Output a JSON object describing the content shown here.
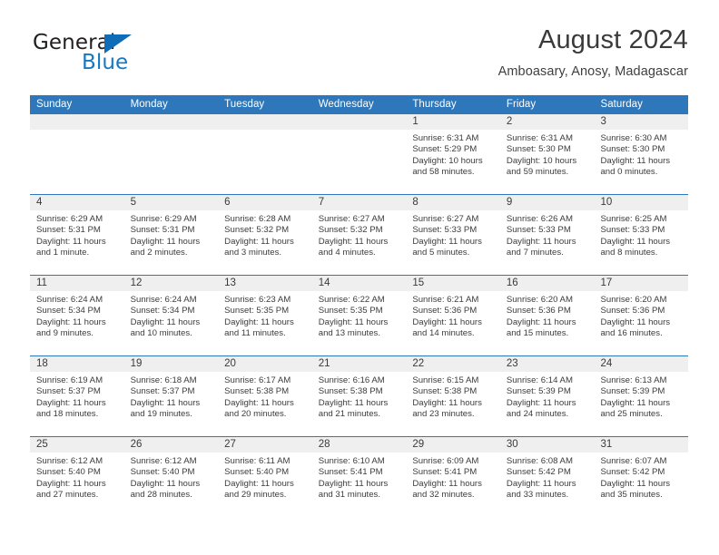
{
  "brand": {
    "name_top": "General",
    "name_bottom": "Blue",
    "triangle_icon": "blue-triangle-icon",
    "color_dark": "#231f20",
    "color_blue": "#1479c4"
  },
  "header": {
    "title": "August 2024",
    "subtitle": "Amboasary, Anosy, Madagascar"
  },
  "theme": {
    "header_blue": "#2e77bb",
    "daynum_band": "#efefef",
    "text": "#3c3c3c"
  },
  "calendar": {
    "weekdays": [
      "Sunday",
      "Monday",
      "Tuesday",
      "Wednesday",
      "Thursday",
      "Friday",
      "Saturday"
    ],
    "weeks": [
      [
        {
          "day": "",
          "empty": true
        },
        {
          "day": "",
          "empty": true
        },
        {
          "day": "",
          "empty": true
        },
        {
          "day": "",
          "empty": true
        },
        {
          "day": "1",
          "sunrise": "Sunrise: 6:31 AM",
          "sunset": "Sunset: 5:29 PM",
          "daylight": "Daylight: 10 hours and 58 minutes."
        },
        {
          "day": "2",
          "sunrise": "Sunrise: 6:31 AM",
          "sunset": "Sunset: 5:30 PM",
          "daylight": "Daylight: 10 hours and 59 minutes."
        },
        {
          "day": "3",
          "sunrise": "Sunrise: 6:30 AM",
          "sunset": "Sunset: 5:30 PM",
          "daylight": "Daylight: 11 hours and 0 minutes."
        }
      ],
      [
        {
          "day": "4",
          "sunrise": "Sunrise: 6:29 AM",
          "sunset": "Sunset: 5:31 PM",
          "daylight": "Daylight: 11 hours and 1 minute."
        },
        {
          "day": "5",
          "sunrise": "Sunrise: 6:29 AM",
          "sunset": "Sunset: 5:31 PM",
          "daylight": "Daylight: 11 hours and 2 minutes."
        },
        {
          "day": "6",
          "sunrise": "Sunrise: 6:28 AM",
          "sunset": "Sunset: 5:32 PM",
          "daylight": "Daylight: 11 hours and 3 minutes."
        },
        {
          "day": "7",
          "sunrise": "Sunrise: 6:27 AM",
          "sunset": "Sunset: 5:32 PM",
          "daylight": "Daylight: 11 hours and 4 minutes."
        },
        {
          "day": "8",
          "sunrise": "Sunrise: 6:27 AM",
          "sunset": "Sunset: 5:33 PM",
          "daylight": "Daylight: 11 hours and 5 minutes."
        },
        {
          "day": "9",
          "sunrise": "Sunrise: 6:26 AM",
          "sunset": "Sunset: 5:33 PM",
          "daylight": "Daylight: 11 hours and 7 minutes."
        },
        {
          "day": "10",
          "sunrise": "Sunrise: 6:25 AM",
          "sunset": "Sunset: 5:33 PM",
          "daylight": "Daylight: 11 hours and 8 minutes."
        }
      ],
      [
        {
          "day": "11",
          "sunrise": "Sunrise: 6:24 AM",
          "sunset": "Sunset: 5:34 PM",
          "daylight": "Daylight: 11 hours and 9 minutes."
        },
        {
          "day": "12",
          "sunrise": "Sunrise: 6:24 AM",
          "sunset": "Sunset: 5:34 PM",
          "daylight": "Daylight: 11 hours and 10 minutes."
        },
        {
          "day": "13",
          "sunrise": "Sunrise: 6:23 AM",
          "sunset": "Sunset: 5:35 PM",
          "daylight": "Daylight: 11 hours and 11 minutes."
        },
        {
          "day": "14",
          "sunrise": "Sunrise: 6:22 AM",
          "sunset": "Sunset: 5:35 PM",
          "daylight": "Daylight: 11 hours and 13 minutes."
        },
        {
          "day": "15",
          "sunrise": "Sunrise: 6:21 AM",
          "sunset": "Sunset: 5:36 PM",
          "daylight": "Daylight: 11 hours and 14 minutes."
        },
        {
          "day": "16",
          "sunrise": "Sunrise: 6:20 AM",
          "sunset": "Sunset: 5:36 PM",
          "daylight": "Daylight: 11 hours and 15 minutes."
        },
        {
          "day": "17",
          "sunrise": "Sunrise: 6:20 AM",
          "sunset": "Sunset: 5:36 PM",
          "daylight": "Daylight: 11 hours and 16 minutes."
        }
      ],
      [
        {
          "day": "18",
          "sunrise": "Sunrise: 6:19 AM",
          "sunset": "Sunset: 5:37 PM",
          "daylight": "Daylight: 11 hours and 18 minutes."
        },
        {
          "day": "19",
          "sunrise": "Sunrise: 6:18 AM",
          "sunset": "Sunset: 5:37 PM",
          "daylight": "Daylight: 11 hours and 19 minutes."
        },
        {
          "day": "20",
          "sunrise": "Sunrise: 6:17 AM",
          "sunset": "Sunset: 5:38 PM",
          "daylight": "Daylight: 11 hours and 20 minutes."
        },
        {
          "day": "21",
          "sunrise": "Sunrise: 6:16 AM",
          "sunset": "Sunset: 5:38 PM",
          "daylight": "Daylight: 11 hours and 21 minutes."
        },
        {
          "day": "22",
          "sunrise": "Sunrise: 6:15 AM",
          "sunset": "Sunset: 5:38 PM",
          "daylight": "Daylight: 11 hours and 23 minutes."
        },
        {
          "day": "23",
          "sunrise": "Sunrise: 6:14 AM",
          "sunset": "Sunset: 5:39 PM",
          "daylight": "Daylight: 11 hours and 24 minutes."
        },
        {
          "day": "24",
          "sunrise": "Sunrise: 6:13 AM",
          "sunset": "Sunset: 5:39 PM",
          "daylight": "Daylight: 11 hours and 25 minutes."
        }
      ],
      [
        {
          "day": "25",
          "sunrise": "Sunrise: 6:12 AM",
          "sunset": "Sunset: 5:40 PM",
          "daylight": "Daylight: 11 hours and 27 minutes."
        },
        {
          "day": "26",
          "sunrise": "Sunrise: 6:12 AM",
          "sunset": "Sunset: 5:40 PM",
          "daylight": "Daylight: 11 hours and 28 minutes."
        },
        {
          "day": "27",
          "sunrise": "Sunrise: 6:11 AM",
          "sunset": "Sunset: 5:40 PM",
          "daylight": "Daylight: 11 hours and 29 minutes."
        },
        {
          "day": "28",
          "sunrise": "Sunrise: 6:10 AM",
          "sunset": "Sunset: 5:41 PM",
          "daylight": "Daylight: 11 hours and 31 minutes."
        },
        {
          "day": "29",
          "sunrise": "Sunrise: 6:09 AM",
          "sunset": "Sunset: 5:41 PM",
          "daylight": "Daylight: 11 hours and 32 minutes."
        },
        {
          "day": "30",
          "sunrise": "Sunrise: 6:08 AM",
          "sunset": "Sunset: 5:42 PM",
          "daylight": "Daylight: 11 hours and 33 minutes."
        },
        {
          "day": "31",
          "sunrise": "Sunrise: 6:07 AM",
          "sunset": "Sunset: 5:42 PM",
          "daylight": "Daylight: 11 hours and 35 minutes."
        }
      ]
    ]
  }
}
